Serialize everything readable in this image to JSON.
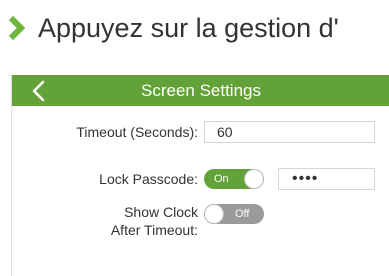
{
  "instruction": {
    "text": "Appuyez sur la gestion d'",
    "arrow_icon": "chevron-right-icon",
    "arrow_color": "#6fb43f"
  },
  "screen": {
    "title": "Screen Settings",
    "back_icon": "chevron-left-icon",
    "title_bar_color": "#62a238",
    "settings": {
      "timeout": {
        "label": "Timeout (Seconds):",
        "value": "60"
      },
      "lock_passcode": {
        "label": "Lock Passcode:",
        "toggle_label": "On",
        "enabled": true,
        "passcode_value": "••••"
      },
      "show_clock": {
        "label_line1": "Show Clock",
        "label_line2": "After Timeout:",
        "toggle_label": "Off",
        "enabled": false
      }
    }
  }
}
